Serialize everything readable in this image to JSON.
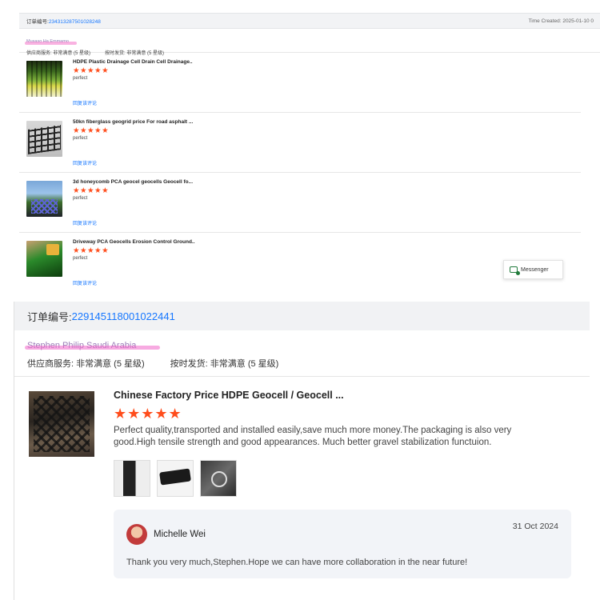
{
  "top": {
    "order_label": "订单编号:",
    "order_number": "234313287501028248",
    "time_created": "Time Created: 2025-01-10 0",
    "seller_name": "Musaso Ha Emmamo",
    "rating_service": "供应商服务: 非常满意 (5 星级)",
    "rating_delivery": "按时发货: 非常满意 (5 星级)",
    "items": [
      {
        "title": "HDPE Plastic Drainage Cell Drain Cell Drainage..",
        "stars": "★★★★★",
        "comment": "perfect",
        "reply_link": "回复该评论"
      },
      {
        "title": "50kn fiberglass geogrid price For road asphalt ...",
        "stars": "★★★★★",
        "comment": "perfect",
        "reply_link": "回复该评论"
      },
      {
        "title": "3d honeycomb PCA geocel geocells Geocell fo...",
        "stars": "★★★★★",
        "comment": "perfect",
        "reply_link": "回复该评论"
      },
      {
        "title": "Driveway PCA Geocells Erosion Control Ground..",
        "stars": "★★★★★",
        "comment": "perfect",
        "reply_link": "回复该评论"
      }
    ],
    "messenger_label": "Messenger"
  },
  "bottom": {
    "order_label": "订单编号:",
    "order_number": "229145118001022441",
    "seller_name": "Stephen Philip Saudi Arabia",
    "rating_service": "供应商服务: 非常满意 (5 星级)",
    "rating_delivery": "按时发货: 非常满意 (5 星级)",
    "product_title": "Chinese Factory Price HDPE Geocell / Geocell ...",
    "stars": "★★★★★",
    "review_text": "Perfect quality,transported and installed easily,save much more money.The packaging is also very good.High tensile strength and good appearances. Much better gravel stabilization functuion.",
    "reply": {
      "replier_name": "Michelle Wei",
      "date": "31 Oct 2024",
      "text": "Thank you very much,Stephen.Hope we can have more collaboration in the near future!"
    }
  },
  "colors": {
    "accent_link": "#1677ff",
    "star": "#ff4d1c",
    "header_bg": "#f1f2f4",
    "reply_bg": "#f2f4f8"
  },
  "icons": [
    "messenger-icon",
    "avatar"
  ]
}
